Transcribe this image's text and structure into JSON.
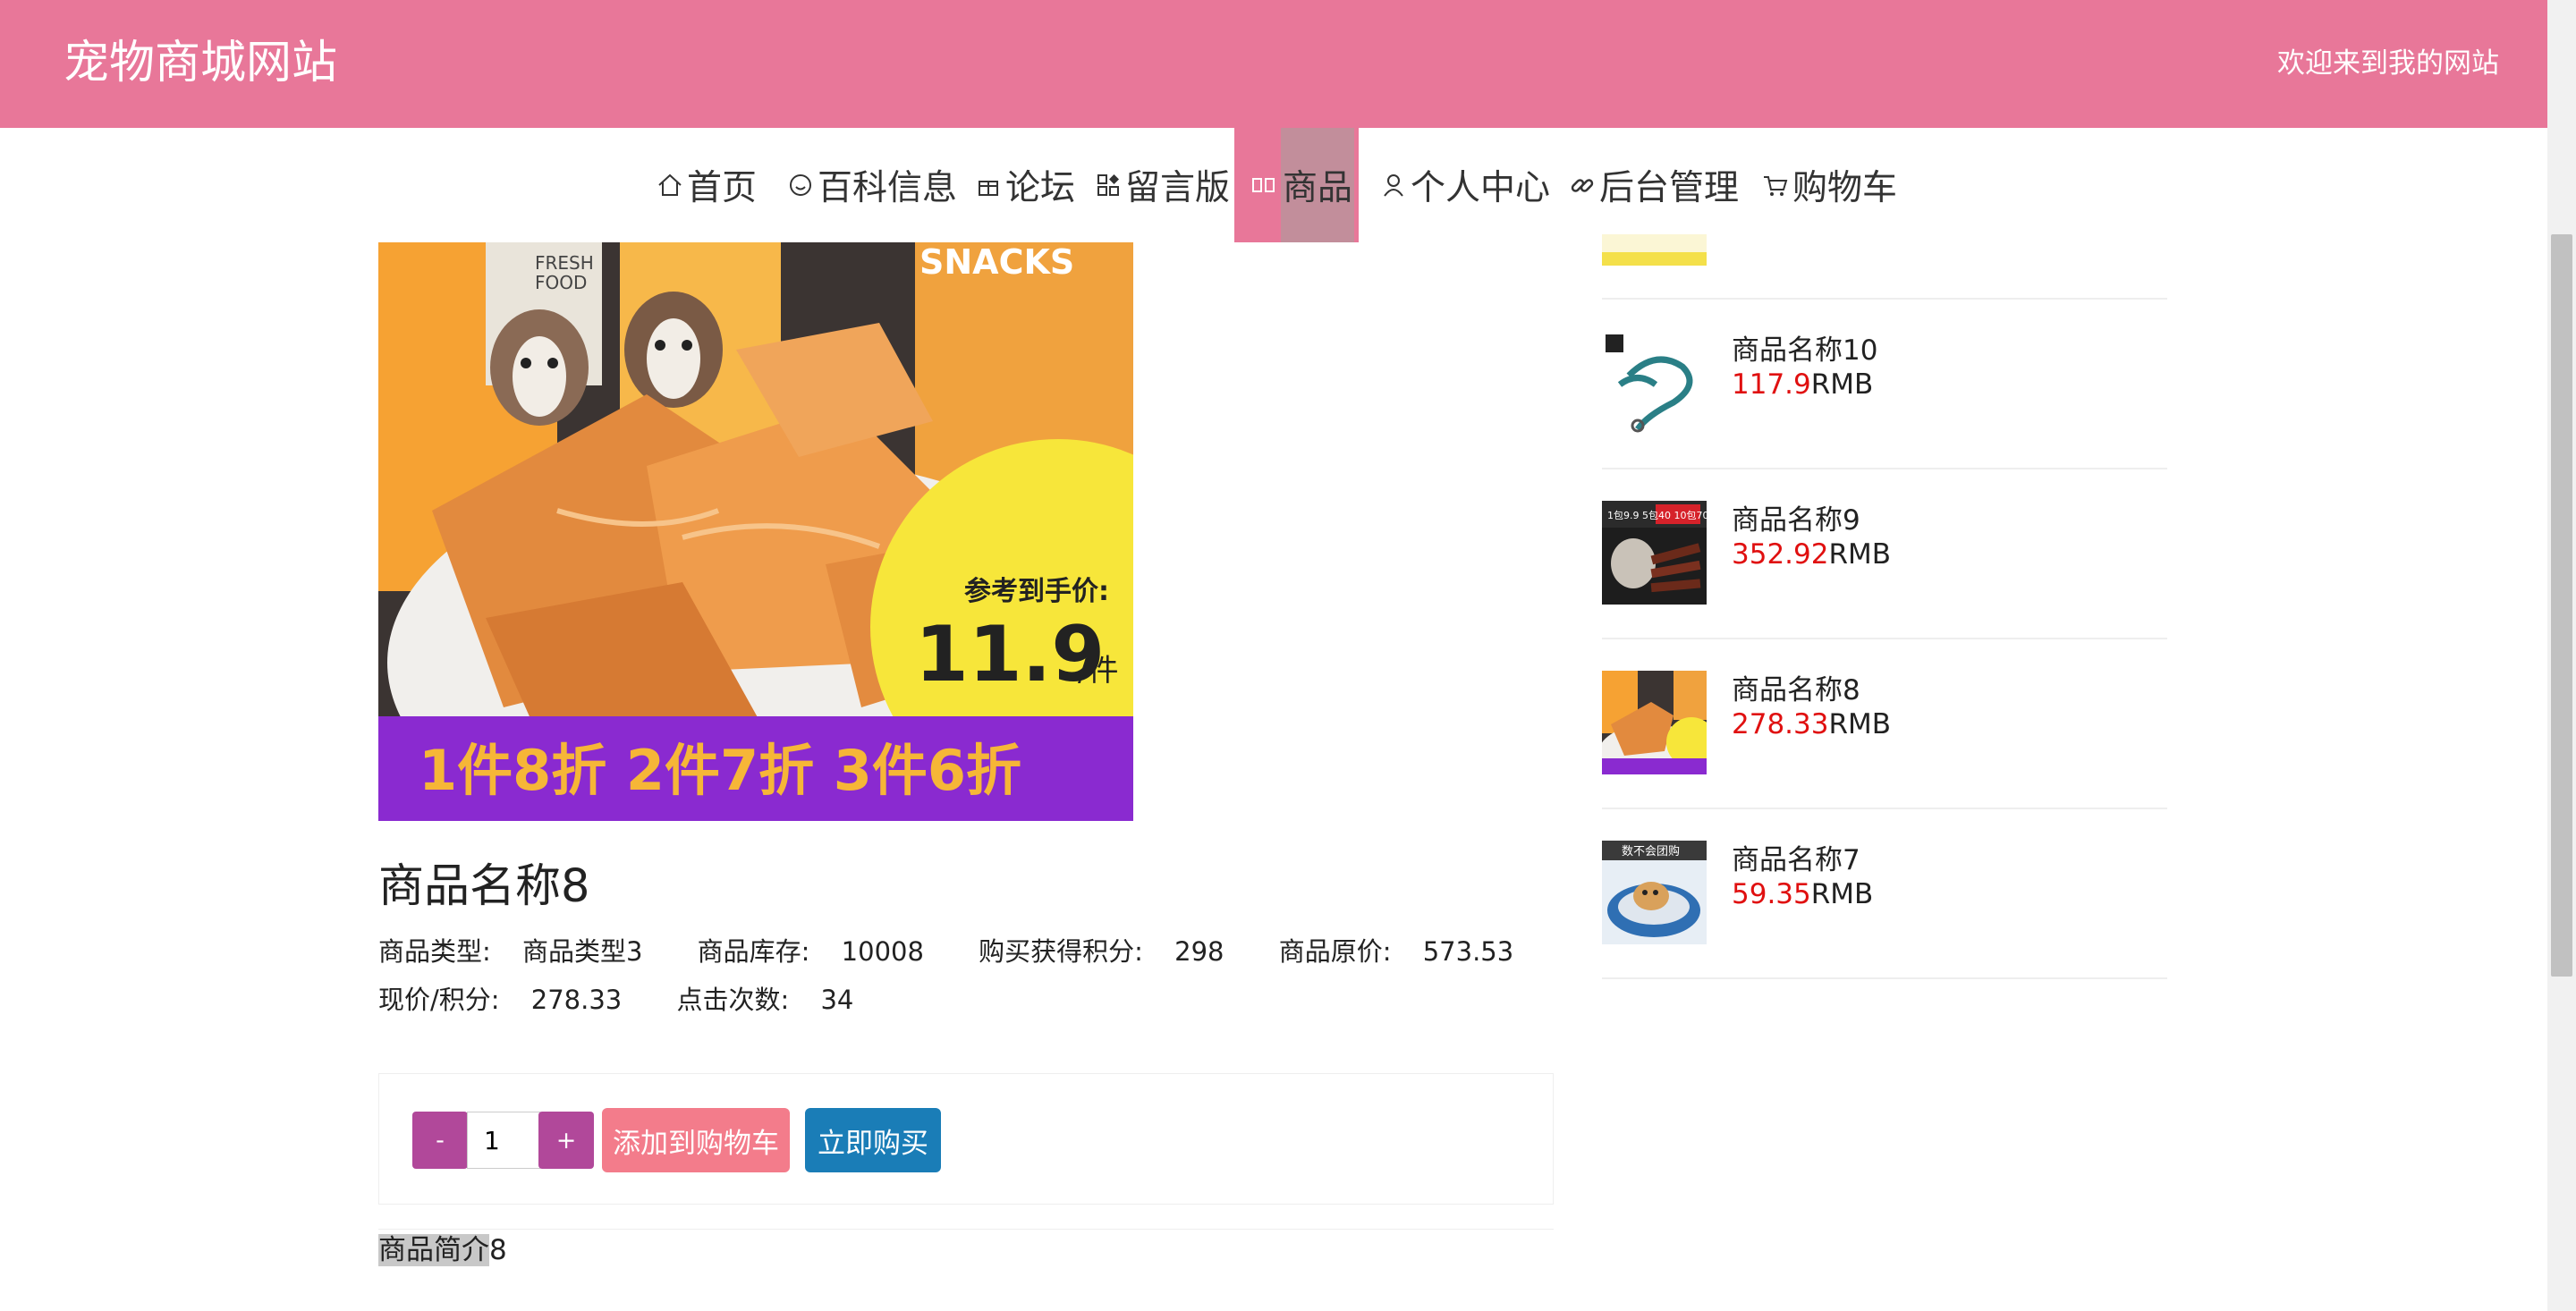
{
  "header": {
    "site_title": "宠物商城网站",
    "welcome": "欢迎来到我的网站"
  },
  "nav": [
    {
      "label": "首页",
      "icon": "home-icon"
    },
    {
      "label": "百科信息",
      "icon": "smile-icon"
    },
    {
      "label": "论坛",
      "icon": "gift-icon"
    },
    {
      "label": "留言版",
      "icon": "grid-icon"
    },
    {
      "label": "商品",
      "icon": "goods-icon",
      "active": true
    },
    {
      "label": "个人中心",
      "icon": "user-icon"
    },
    {
      "label": "后台管理",
      "icon": "link-icon"
    },
    {
      "label": "购物车",
      "icon": "cart-icon"
    }
  ],
  "product": {
    "image": {
      "snacks_label": "SNACKS",
      "fresh_label": "FRESH",
      "food_label": "FOOD",
      "price_caption": "参考到手价:",
      "price_value": "11.9",
      "price_unit": "/件",
      "promo_banner": "1件8折 2件7折 3件6折"
    },
    "title": "商品名称8",
    "meta_row1": [
      {
        "label": "商品类型:",
        "value": "商品类型3"
      },
      {
        "label": "商品库存:",
        "value": "10008"
      },
      {
        "label": "购买获得积分:",
        "value": "298"
      },
      {
        "label": "商品原价:",
        "value": "573.53"
      }
    ],
    "meta_row2": [
      {
        "label": "现价/积分:",
        "value": "278.33"
      },
      {
        "label": "点击次数:",
        "value": "34"
      }
    ],
    "quantity": "1",
    "minus_label": "-",
    "plus_label": "+",
    "add_to_cart": "添加到购物车",
    "buy_now": "立即购买",
    "intro_selected": "商品简介",
    "intro_rest": "8"
  },
  "sidebar": {
    "items": [
      {
        "name": "商品名称10",
        "price": "117.9",
        "currency": "RMB"
      },
      {
        "name": "商品名称9",
        "price": "352.92",
        "currency": "RMB"
      },
      {
        "name": "商品名称8",
        "price": "278.33",
        "currency": "RMB"
      },
      {
        "name": "商品名称7",
        "price": "59.35",
        "currency": "RMB"
      }
    ],
    "thumb_texts": {
      "item9_badge": "1包9.9 5包40 10包70",
      "item7_badge": "数不会团购"
    }
  },
  "colors": {
    "header_bg": "#e87799",
    "price_red": "#e01010",
    "qty_btn": "#b1489a",
    "cart_btn": "#f37c8b",
    "buy_btn": "#1a7db7"
  }
}
